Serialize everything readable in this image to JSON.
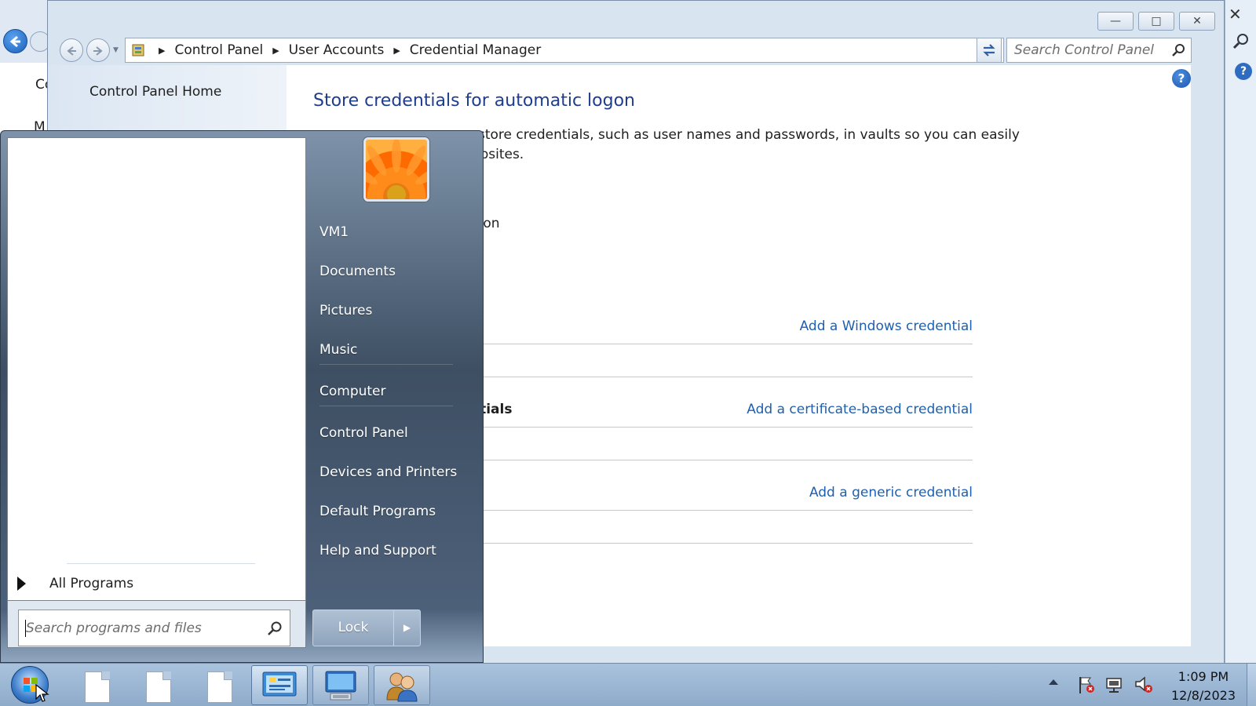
{
  "background_window": {
    "text_c": "Co",
    "text_m": "M",
    "close_glyph": "✕"
  },
  "window": {
    "controls": {
      "minimize": "—",
      "maximize": "□",
      "close": "✕"
    },
    "breadcrumbs": [
      "Control Panel",
      "User Accounts",
      "Credential Manager"
    ],
    "search_placeholder": "Search Control Panel"
  },
  "left_pane": {
    "home_link": "Control Panel Home"
  },
  "content": {
    "title": "Store credentials for automatic logon",
    "description_line1": "store credentials, such as user names and passwords, in vaults so you can easily",
    "description_line2": "ebsites.",
    "description_partial": "tion",
    "sections": [
      {
        "title": "",
        "link": "Add a Windows credential"
      },
      {
        "title": "ntials",
        "link": "Add a certificate-based credential"
      },
      {
        "title": "",
        "link": "Add a generic credential"
      }
    ]
  },
  "start_menu": {
    "all_programs": "All Programs",
    "search_placeholder": "Search programs and files",
    "right_items": [
      "VM1",
      "Documents",
      "Pictures",
      "Music",
      "Computer",
      "Control Panel",
      "Devices and Printers",
      "Default Programs",
      "Help and Support"
    ],
    "lock_label": "Lock",
    "lock_arrow": "▶"
  },
  "taskbar": {
    "time": "1:09 PM",
    "date": "12/8/2023"
  },
  "colors": {
    "title_blue": "#1e3d8f",
    "link_blue": "#1f5fb0",
    "taskbar": "#9fb9d6"
  }
}
